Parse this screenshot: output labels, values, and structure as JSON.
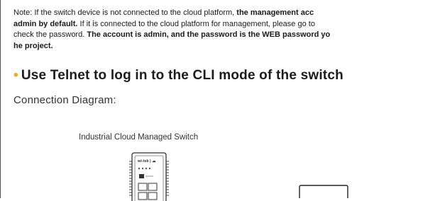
{
  "note": {
    "line1_plain": "Note: If the switch device is not connected to the cloud platform, ",
    "line1_bold": "the management acc",
    "line2_bold": "admin by default.",
    "line2_plain": " If it is connected to the cloud platform for management, please go to",
    "line3_plain": "check the password. ",
    "line3_bold": "The account is admin, and the password is the WEB password yo",
    "line4_bold": "he project."
  },
  "section": {
    "bullet": "•",
    "title": "Use Telnet to log in to the CLI mode of the switch"
  },
  "diagram": {
    "caption": "Connection Diagram:",
    "device_label": "Industrial Cloud Managed Switch",
    "switch_logo_text": "wi-tek | ☁"
  },
  "colors": {
    "bullet": "#f5a623",
    "text": "#1a1a1a",
    "border": "#555555"
  }
}
